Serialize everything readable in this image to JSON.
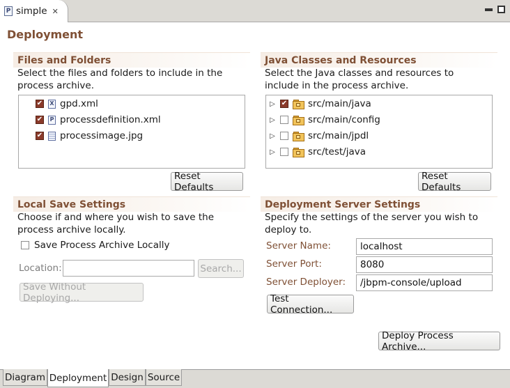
{
  "editor_tab": {
    "icon_letter": "P",
    "title": "simple",
    "close_glyph": "✕"
  },
  "page_title": "Deployment",
  "files_section": {
    "title": "Files and Folders",
    "description": "Select the files and folders to include in the process archive.",
    "items": [
      {
        "label": "gpd.xml",
        "checked": true,
        "icon": "xml-file-icon",
        "icon_letter": "X"
      },
      {
        "label": "processdefinition.xml",
        "checked": true,
        "icon": "process-file-icon",
        "icon_letter": "P"
      },
      {
        "label": "processimage.jpg",
        "checked": true,
        "icon": "image-file-icon",
        "icon_letter": ""
      }
    ],
    "reset_label": "Reset Defaults"
  },
  "java_section": {
    "title": "Java Classes and Resources",
    "description": "Select the Java classes and resources to include in the process archive.",
    "items": [
      {
        "label": "src/main/java",
        "checked": true
      },
      {
        "label": "src/main/config",
        "checked": false
      },
      {
        "label": "src/main/jpdl",
        "checked": false
      },
      {
        "label": "src/test/java",
        "checked": false
      }
    ],
    "reset_label": "Reset Defaults"
  },
  "local_save": {
    "title": "Local Save Settings",
    "description": "Choose if and where you wish to save the process archive locally.",
    "save_checkbox_label": "Save Process Archive Locally",
    "save_checked": false,
    "location_label": "Location:",
    "location_value": "",
    "search_label": "Search...",
    "save_without_deploying_label": "Save Without Deploying..."
  },
  "server_settings": {
    "title": "Deployment Server Settings",
    "description": "Specify the settings of the server you wish to deploy to.",
    "name_label": "Server Name:",
    "name_value": "localhost",
    "port_label": "Server Port:",
    "port_value": "8080",
    "deployer_label": "Server Deployer:",
    "deployer_value": "/jbpm-console/upload",
    "test_connection_label": "Test Connection..."
  },
  "deploy_label": "Deploy Process Archive...",
  "bottom_tabs": [
    {
      "label": "Diagram",
      "active": false
    },
    {
      "label": "Deployment",
      "active": true
    },
    {
      "label": "Design",
      "active": false
    },
    {
      "label": "Source",
      "active": false
    }
  ],
  "colors": {
    "section_title": "#7f5035",
    "checkbox_checked": "#8a3a2a",
    "folder": "#f1c35a"
  }
}
